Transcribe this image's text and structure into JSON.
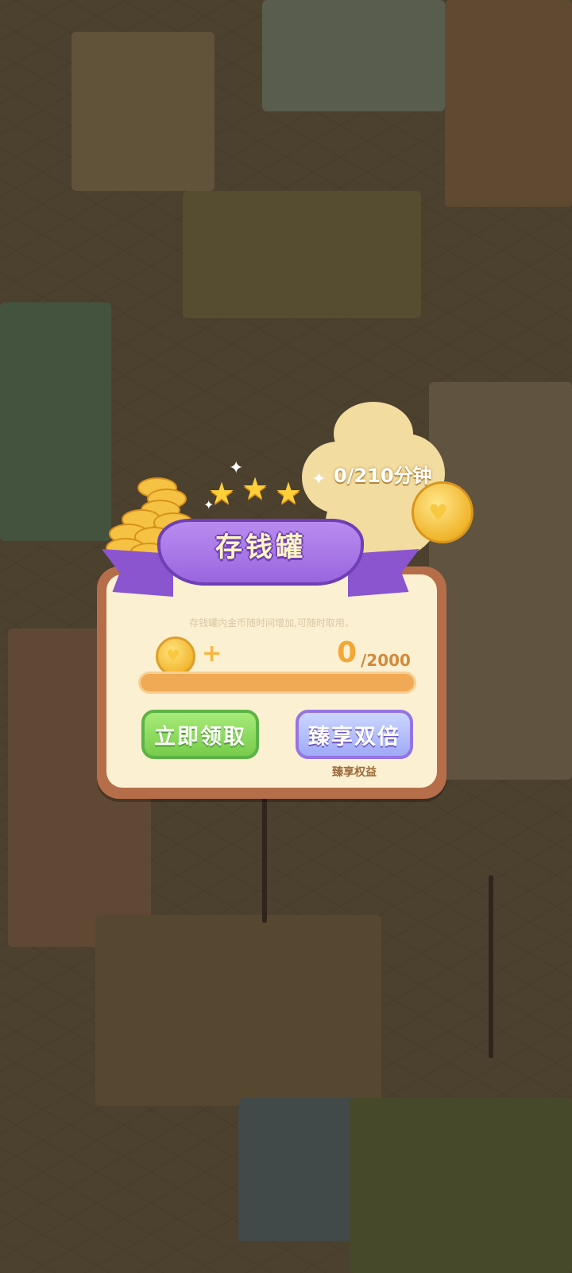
{
  "piggy_bank": {
    "title": "存钱罐",
    "timer": "0/210分钟",
    "description": "存钱罐内金币随时间增加,可随时取用。",
    "plus_sign": "+",
    "coin_count": "0",
    "coin_limit": "/2000",
    "progress_fraction": 0,
    "stars": 3
  },
  "buttons": {
    "claim_now": "立即领取",
    "enjoy_double": "臻享双倍",
    "perk_label": "臻享权益"
  },
  "icons": {
    "coin": "coin-heart-icon",
    "star": "star-icon",
    "coin_pile": "coin-pile-icon"
  },
  "colors": {
    "ribbon_purple": "#9a66df",
    "claim_green": "#78cb4d",
    "double_lavender": "#9fa9f7",
    "panel_cream": "#fcf0d2",
    "coin_gold": "#f2b833"
  }
}
